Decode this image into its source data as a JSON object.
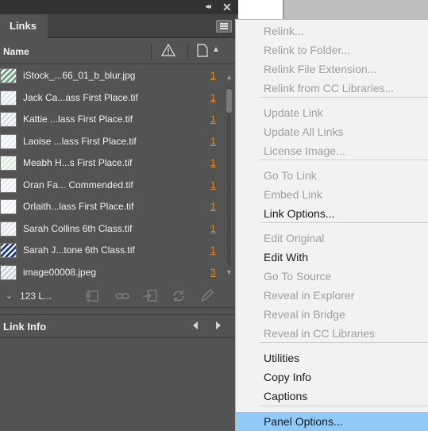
{
  "window": {
    "collapse_glyph": "◂◂",
    "close_glyph": "✕"
  },
  "panel": {
    "tab_label": "Links",
    "column_name": "Name",
    "status_text": "123 L...",
    "link_info_title": "Link Info"
  },
  "links": [
    {
      "name": "iStock_...66_01_b_blur.jpg",
      "page": "1",
      "thumb": "#6aa07a"
    },
    {
      "name": "Jack Ca...ass First Place.tif",
      "page": "1",
      "thumb": "#dfe6ef"
    },
    {
      "name": "Kattie ...lass First Place.tif",
      "page": "1",
      "thumb": "#d8dff4"
    },
    {
      "name": "Laoise ...lass First Place.tif",
      "page": "1",
      "thumb": "#e6eef6"
    },
    {
      "name": "Meabh H...s First Place.tif",
      "page": "1",
      "thumb": "#d9eddf"
    },
    {
      "name": "Oran Fa... Commended.tif",
      "page": "1",
      "thumb": "#e9edf3"
    },
    {
      "name": "Orlaith...lass First Place.tif",
      "page": "1",
      "thumb": "#eef1f5"
    },
    {
      "name": "Sarah Collins 6th Class.tif",
      "page": "1",
      "thumb": "#e3e6ee"
    },
    {
      "name": "Sarah J...tone 6th Class.tif",
      "page": "1",
      "thumb": "#1f3d8a"
    },
    {
      "name": "image00008.jpeg",
      "page": "3",
      "thumb": "#c9d4ea"
    }
  ],
  "menu": {
    "items": [
      {
        "label": "Relink...",
        "enabled": false
      },
      {
        "label": "Relink to Folder...",
        "enabled": false
      },
      {
        "label": "Relink File Extension...",
        "enabled": false
      },
      {
        "label": "Relink from CC Libraries...",
        "enabled": false
      },
      {
        "label": "Update Link",
        "enabled": false
      },
      {
        "label": "Update All Links",
        "enabled": false
      },
      {
        "label": "License Image...",
        "enabled": false
      },
      {
        "label": "Go To Link",
        "enabled": false
      },
      {
        "label": "Embed Link",
        "enabled": false
      },
      {
        "label": "Link Options...",
        "enabled": true
      },
      {
        "label": "Edit Original",
        "enabled": false
      },
      {
        "label": "Edit With",
        "enabled": true
      },
      {
        "label": "Go To Source",
        "enabled": false
      },
      {
        "label": "Reveal in Explorer",
        "enabled": false
      },
      {
        "label": "Reveal in Bridge",
        "enabled": false
      },
      {
        "label": "Reveal in CC Libraries",
        "enabled": false
      },
      {
        "label": "Utilities",
        "enabled": true
      },
      {
        "label": "Copy Info",
        "enabled": true
      },
      {
        "label": "Captions",
        "enabled": true
      },
      {
        "label": "Panel Options...",
        "enabled": true,
        "selected": true
      }
    ]
  },
  "colors": {
    "page_link": "#e0902c",
    "menu_highlight": "#91c9f7",
    "panel_bg": "#535353"
  }
}
